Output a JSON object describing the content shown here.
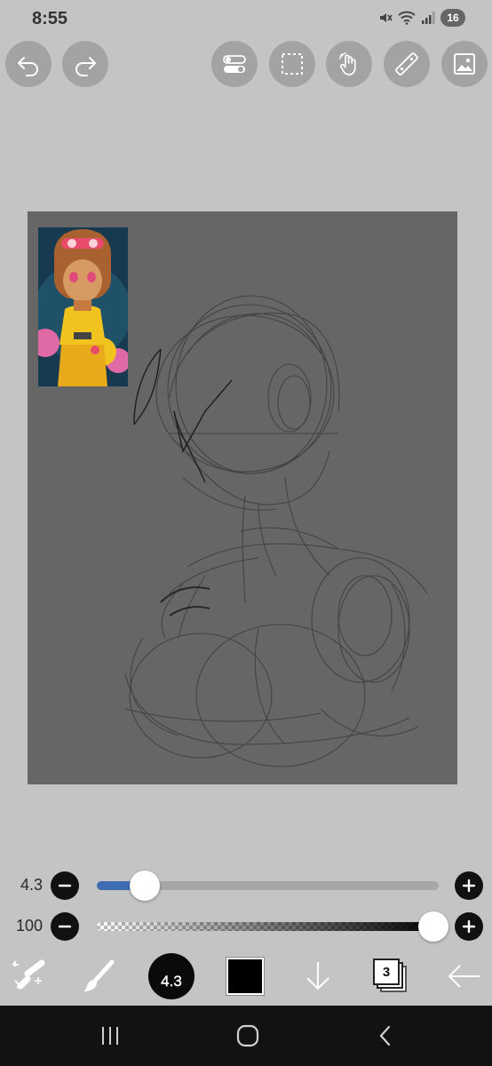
{
  "status_bar": {
    "time": "8:55",
    "battery": "16",
    "icons": [
      "mute-icon",
      "wifi-icon",
      "signal-icon",
      "battery-icon"
    ]
  },
  "top_toolbar": {
    "left": [
      "undo-icon",
      "redo-icon"
    ],
    "right": [
      "toggle-icon",
      "selection-icon",
      "hand-gesture-icon",
      "ruler-icon",
      "image-icon"
    ]
  },
  "reference_image": {
    "description_icon": "reference-image"
  },
  "sliders": {
    "size": {
      "label": "4.3",
      "value_fraction": 0.14,
      "accent": "#3f6db1"
    },
    "opacity": {
      "label": "100",
      "value_fraction": 1.0
    }
  },
  "bottom_tools": {
    "brush_size": "4.3",
    "layer_count": "3",
    "color": "#000000",
    "icons": [
      "transform-eraser-icon",
      "brush-icon",
      "brush-preview",
      "color-swatch",
      "down-arrow-icon",
      "layers-icon",
      "back-arrow-icon"
    ]
  },
  "nav_bar": {
    "icons": [
      "recent-apps-icon",
      "home-icon",
      "back-icon"
    ]
  },
  "colors": {
    "background": "#c4c4c4",
    "canvas": "#666666",
    "button": "#a3a3a3",
    "nav": "#121212"
  }
}
